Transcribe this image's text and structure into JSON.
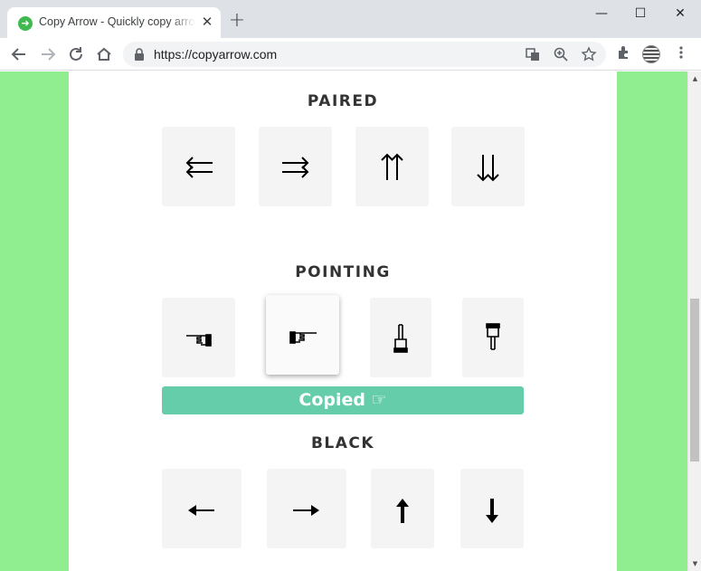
{
  "browser": {
    "tab_title": "Copy Arrow - Quickly copy arrow",
    "tab_close": "✕",
    "new_tab": "+",
    "url": "https://copyarrow.com",
    "window": {
      "minimize": "—",
      "maximize": "☐",
      "close": "✕"
    }
  },
  "sections": [
    {
      "title": "PAIRED",
      "arrows": [
        "⇇",
        "⇉",
        "⇈",
        "⇊"
      ]
    },
    {
      "title": "POINTING",
      "arrows": [
        "☜",
        "☞",
        "☝",
        "☟"
      ]
    },
    {
      "title": "BLACK",
      "arrows": [
        "⟵",
        "⟶",
        "⬆",
        "⬇"
      ]
    }
  ],
  "copied_banner": "Copied ☞",
  "colors": {
    "page_background": "#90ee90",
    "copied_banner": "#66cdaa",
    "tile": "#f4f4f4"
  }
}
